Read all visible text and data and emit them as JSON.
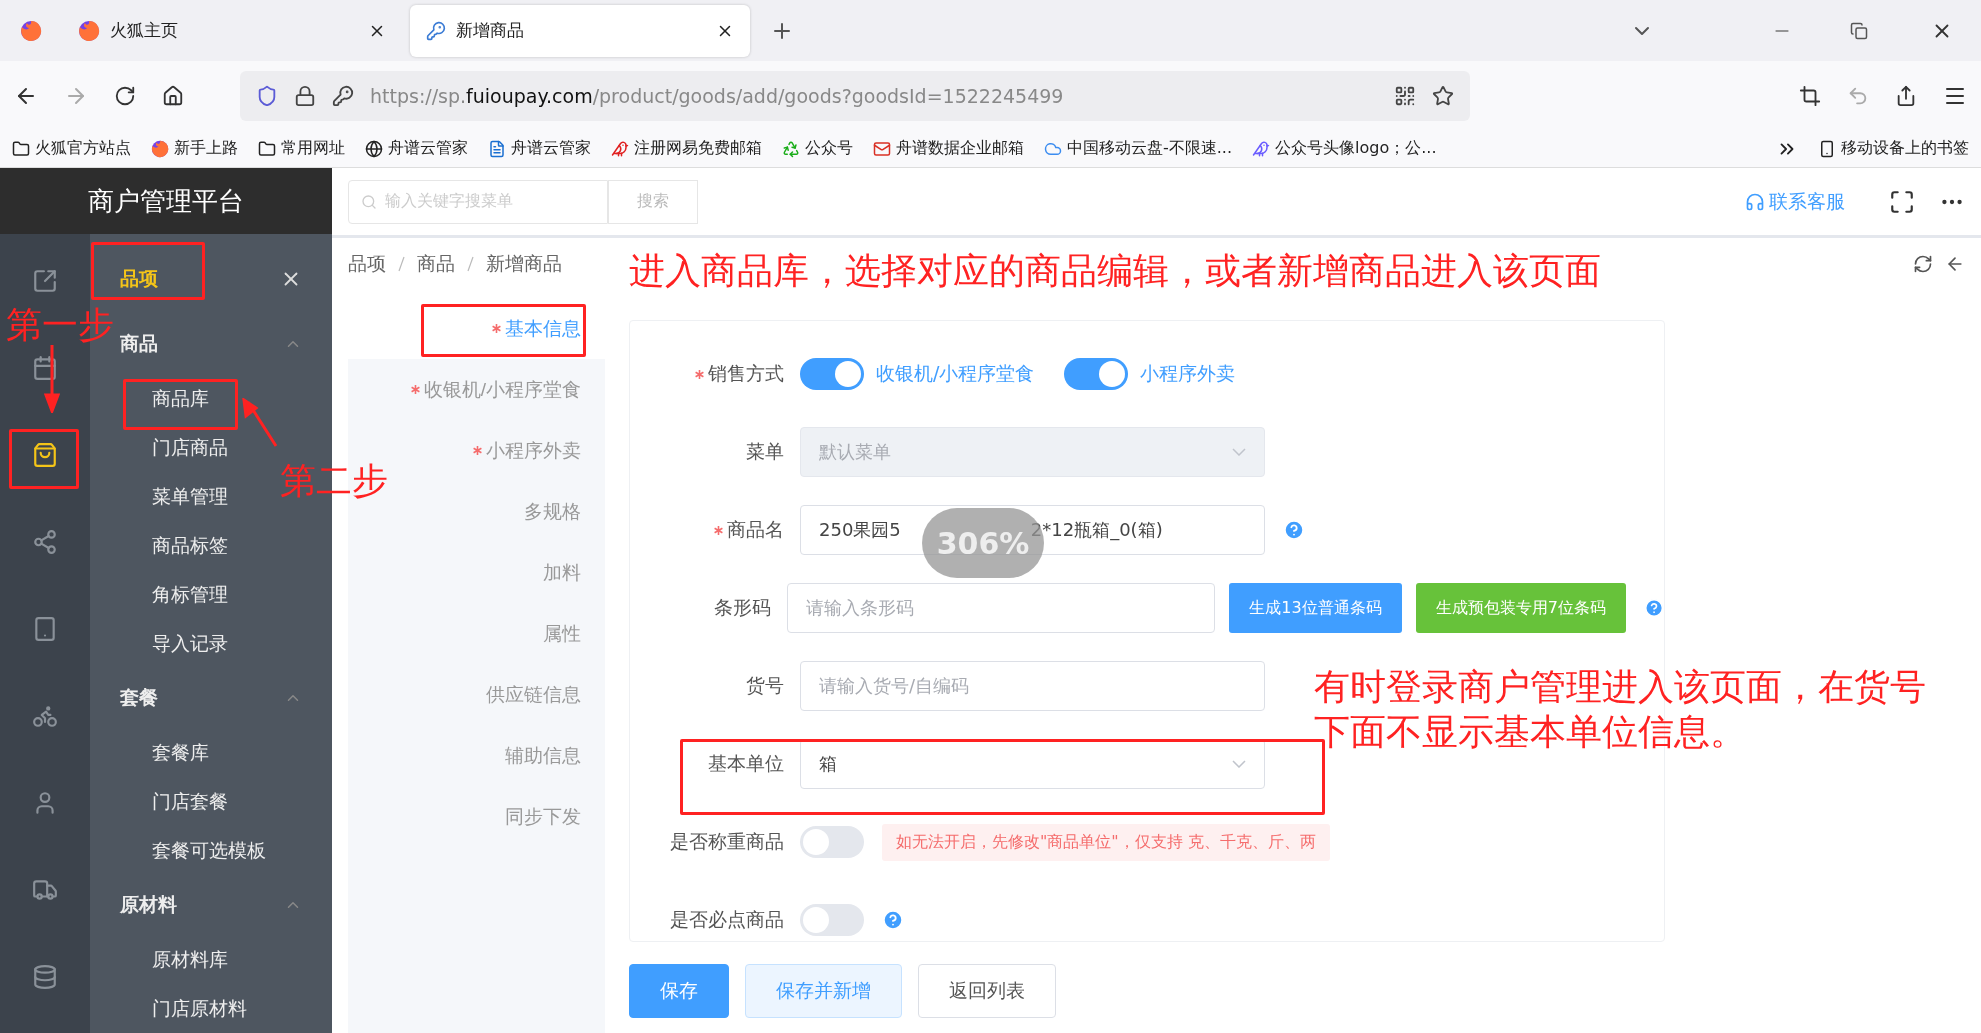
{
  "browser": {
    "tabs": [
      {
        "kind": "firefox",
        "title": "火狐主页",
        "selected": false
      },
      {
        "kind": "key",
        "title": "新增商品",
        "selected": true
      }
    ],
    "url": {
      "prefix": "https://sp.",
      "domain": "fuioupay.com",
      "path": "/product/goods/add/goods?goodsId=1522245499"
    },
    "bookmarks": [
      {
        "kind": "folder",
        "label": "火狐官方站点"
      },
      {
        "kind": "firefox",
        "label": "新手上路"
      },
      {
        "kind": "folder",
        "label": "常用网址"
      },
      {
        "kind": "globe",
        "label": "舟谱云管家"
      },
      {
        "kind": "doc",
        "label": "舟谱云管家"
      },
      {
        "kind": "netease",
        "label": "注册网易免费邮箱"
      },
      {
        "kind": "recycle",
        "label": "公众号"
      },
      {
        "kind": "mail",
        "label": "舟谱数据企业邮箱"
      },
      {
        "kind": "cloud",
        "label": "中国移动云盘-不限速..."
      },
      {
        "kind": "bird",
        "label": "公众号头像logo；公..."
      }
    ],
    "mobile_bookmarks": "移动设备上的书签"
  },
  "app": {
    "title": "商户管理平台",
    "search_placeholder": "输入关键字搜菜单",
    "search_button": "搜索",
    "support": "联系客服"
  },
  "rail": [
    {
      "kind": "export",
      "selected": false
    },
    {
      "kind": "calendar",
      "selected": false
    },
    {
      "kind": "bag",
      "selected": true
    },
    {
      "kind": "share",
      "selected": false
    },
    {
      "kind": "tablet",
      "selected": false
    },
    {
      "kind": "bike",
      "selected": false
    },
    {
      "kind": "user",
      "selected": false
    },
    {
      "kind": "truck",
      "selected": false
    },
    {
      "kind": "database",
      "selected": false
    }
  ],
  "menu": {
    "header": "品项",
    "groups": [
      {
        "label": "商品",
        "expanded": true,
        "items": [
          "商品库",
          "门店商品",
          "菜单管理",
          "商品标签",
          "角标管理",
          "导入记录"
        ]
      },
      {
        "label": "套餐",
        "expanded": true,
        "items": [
          "套餐库",
          "门店套餐",
          "套餐可选模板"
        ]
      },
      {
        "label": "原材料",
        "expanded": true,
        "items": [
          "原材料库",
          "门店原材料"
        ]
      }
    ]
  },
  "breadcrumb": [
    "品项",
    "商品",
    "新增商品"
  ],
  "steps": [
    {
      "label": "基本信息",
      "required": true,
      "selected": true
    },
    {
      "label": "收银机/小程序堂食",
      "required": true,
      "selected": false
    },
    {
      "label": "小程序外卖",
      "required": true,
      "selected": false
    },
    {
      "label": "多规格",
      "selected": false
    },
    {
      "label": "加料",
      "selected": false
    },
    {
      "label": "属性",
      "selected": false
    },
    {
      "label": "供应链信息",
      "selected": false
    },
    {
      "label": "辅助信息",
      "selected": false
    },
    {
      "label": "同步下发",
      "selected": false
    }
  ],
  "form": [
    {
      "kind": "toggles",
      "label": "销售方式",
      "required": true,
      "toggles": [
        {
          "label": "收银机/小程序堂食",
          "on": true
        },
        {
          "label": "小程序外卖",
          "on": true
        }
      ]
    },
    {
      "kind": "select",
      "label": "菜单",
      "placeholder": "默认菜单",
      "disabled": true
    },
    {
      "kind": "input",
      "label": "商品名",
      "required": true,
      "value": "250果园5",
      "value_end": "2*12瓶箱_0(箱)",
      "help": true
    },
    {
      "kind": "barcode",
      "label": "条形码",
      "placeholder": "请输入条形码",
      "buttons": [
        {
          "label": "生成13位普通条码",
          "color": "#409eff"
        },
        {
          "label": "生成预包装专用7位条码",
          "color": "#67c23a"
        }
      ],
      "help": true
    },
    {
      "kind": "input",
      "label": "货号",
      "placeholder": "请输入货号/自编码"
    },
    {
      "kind": "select",
      "label": "基本单位",
      "value": "箱"
    },
    {
      "kind": "switch",
      "label": "是否称重商品",
      "on": false,
      "hint": "如无法开启，先修改\"商品单位\"，仅支持 克、千克、斤、两"
    },
    {
      "kind": "switch",
      "label": "是否必点商品",
      "on": false,
      "help": true
    }
  ],
  "actions": [
    {
      "kind": "primary",
      "label": "保存"
    },
    {
      "kind": "plain-primary",
      "label": "保存并新增"
    },
    {
      "kind": "default",
      "label": "返回列表"
    }
  ],
  "zoom_badge": "306%",
  "annotations": {
    "top": "进入商品库，选择对应的商品编辑，或者新增商品进入该页面",
    "right": "有时登录商户管理进入该页面，在货号下面不显示基本单位信息。",
    "step1": "第一步",
    "step2": "第二步"
  }
}
